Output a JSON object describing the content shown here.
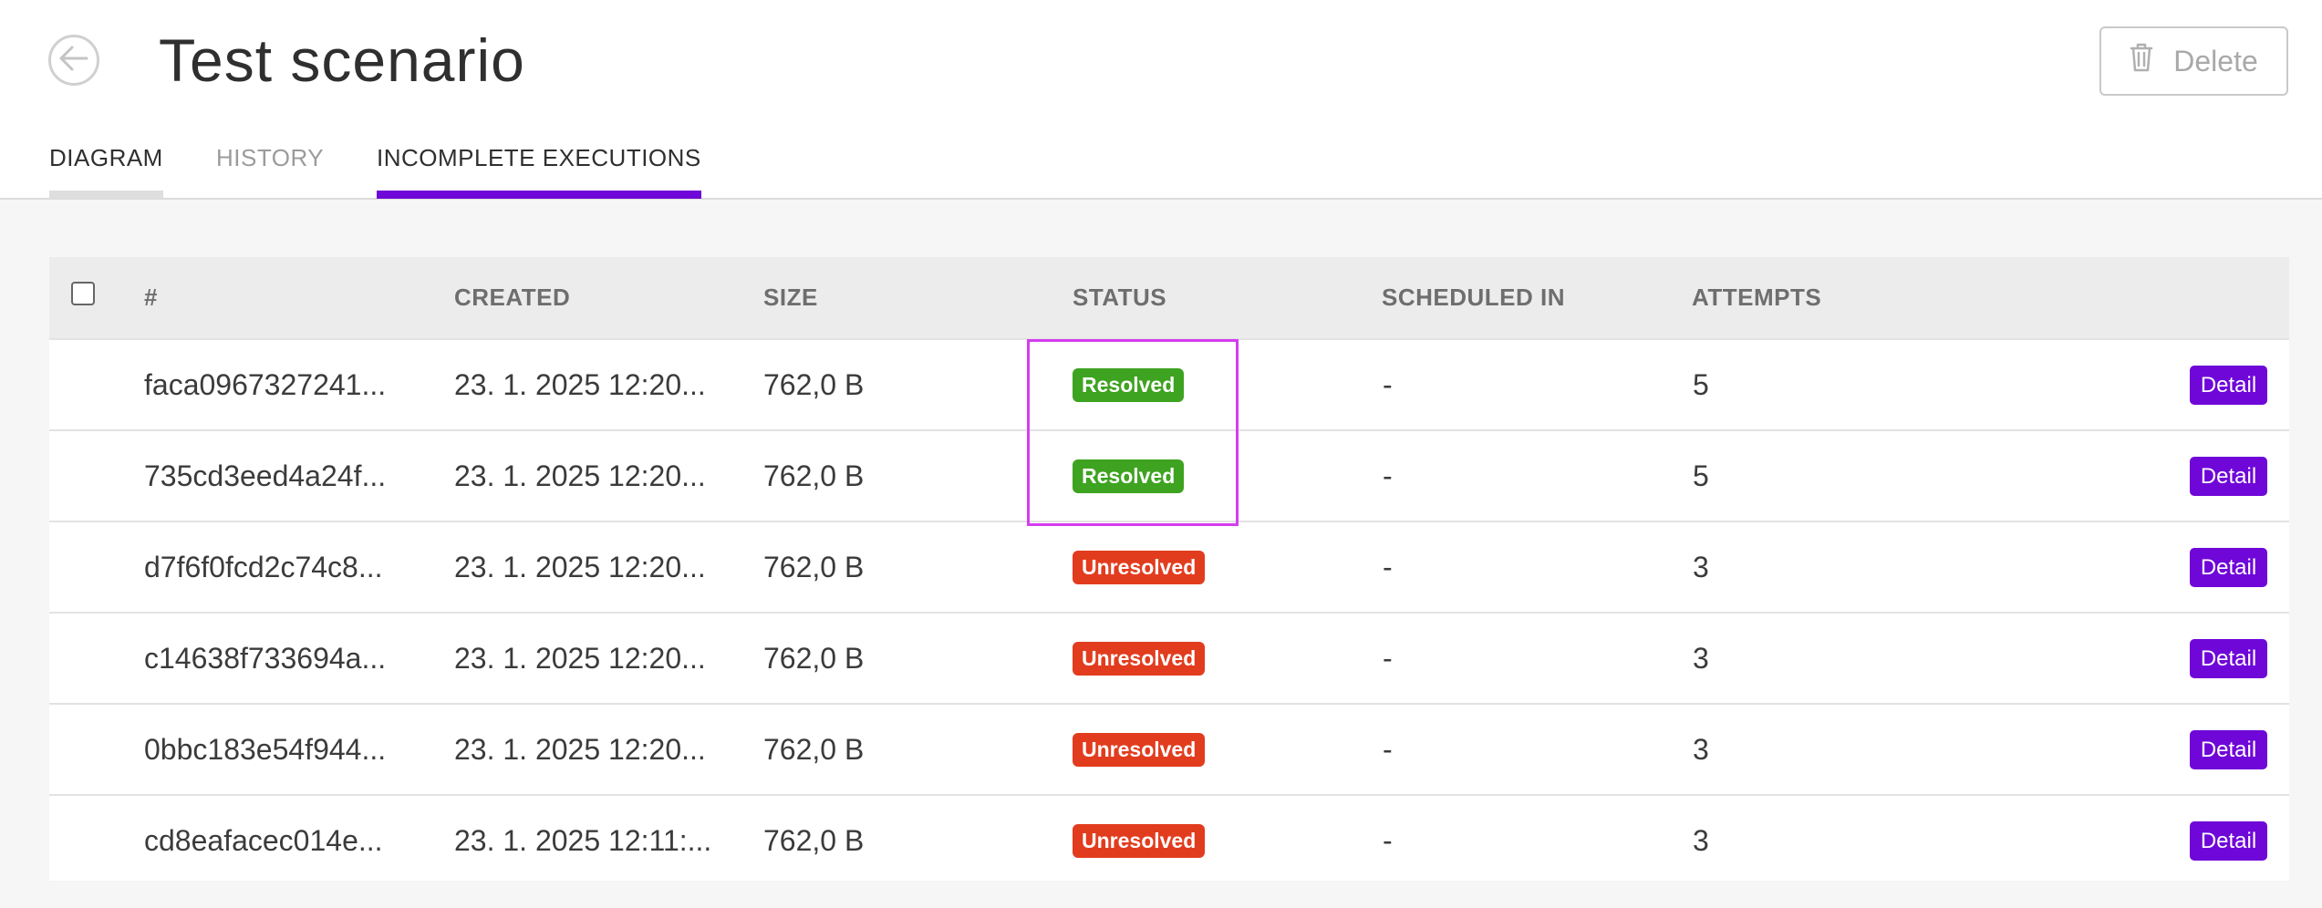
{
  "header": {
    "title": "Test scenario",
    "delete_label": "Delete",
    "icons": {
      "back": "arrow-left-icon",
      "delete": "trash-icon"
    }
  },
  "tabs": [
    {
      "label": "DIAGRAM",
      "active": false
    },
    {
      "label": "HISTORY",
      "active": false
    },
    {
      "label": "INCOMPLETE EXECUTIONS",
      "active": true
    }
  ],
  "table": {
    "columns": [
      "#",
      "CREATED",
      "SIZE",
      "STATUS",
      "SCHEDULED IN",
      "ATTEMPTS"
    ],
    "select_all_checked": false,
    "rows": [
      {
        "id": "faca0967327241...",
        "created": "23. 1. 2025 12:20...",
        "size": "762,0 B",
        "status": "Resolved",
        "scheduled": "-",
        "attempts": "5",
        "action": "Detail"
      },
      {
        "id": "735cd3eed4a24f...",
        "created": "23. 1. 2025 12:20...",
        "size": "762,0 B",
        "status": "Resolved",
        "scheduled": "-",
        "attempts": "5",
        "action": "Detail"
      },
      {
        "id": "d7f6f0fcd2c74c8...",
        "created": "23. 1. 2025 12:20...",
        "size": "762,0 B",
        "status": "Unresolved",
        "scheduled": "-",
        "attempts": "3",
        "action": "Detail"
      },
      {
        "id": "c14638f733694a...",
        "created": "23. 1. 2025 12:20...",
        "size": "762,0 B",
        "status": "Unresolved",
        "scheduled": "-",
        "attempts": "3",
        "action": "Detail"
      },
      {
        "id": "0bbc183e54f944...",
        "created": "23. 1. 2025 12:20...",
        "size": "762,0 B",
        "status": "Unresolved",
        "scheduled": "-",
        "attempts": "3",
        "action": "Detail"
      },
      {
        "id": "cd8eafacec014e...",
        "created": "23. 1. 2025 12:11:...",
        "size": "762,0 B",
        "status": "Unresolved",
        "scheduled": "-",
        "attempts": "3",
        "action": "Detail"
      }
    ]
  },
  "colors": {
    "accent": "#6f07d8",
    "resolved": "#3ea320",
    "unresolved": "#e23c1e",
    "highlight": "#d63cf0"
  }
}
